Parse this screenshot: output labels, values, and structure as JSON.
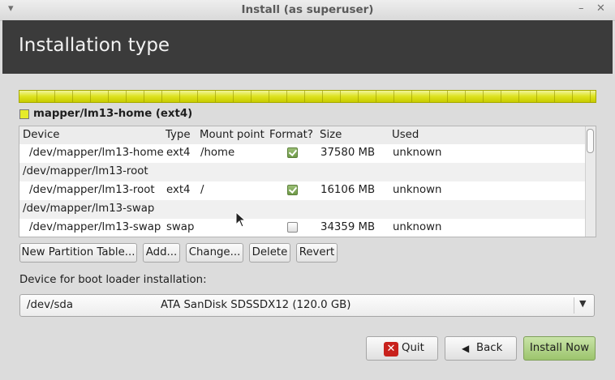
{
  "window": {
    "title": "Install (as superuser)",
    "menu_glyph": "▾",
    "minimize_glyph": "–",
    "close_glyph": "✕"
  },
  "header": {
    "title": "Installation type"
  },
  "colors": {
    "partition_color": "#dde21e",
    "header_bg": "#3b3b3b",
    "install_button": "#9cc46d"
  },
  "selected_partition": {
    "label": "mapper/lm13-home (ext4)"
  },
  "table": {
    "columns": [
      "Device",
      "Type",
      "Mount point",
      "Format?",
      "Size",
      "Used"
    ],
    "rows": [
      {
        "device": "/dev/mapper/lm13-home",
        "type": "ext4",
        "mount": "/home",
        "format": true,
        "size": "37580 MB",
        "used": "unknown"
      },
      {
        "device": "/dev/mapper/lm13-root",
        "type": "",
        "mount": "",
        "format": null,
        "size": "",
        "used": ""
      },
      {
        "device": "/dev/mapper/lm13-root",
        "type": "ext4",
        "mount": "/",
        "format": true,
        "size": "16106 MB",
        "used": "unknown"
      },
      {
        "device": "/dev/mapper/lm13-swap",
        "type": "",
        "mount": "",
        "format": null,
        "size": "",
        "used": ""
      },
      {
        "device": "/dev/mapper/lm13-swap",
        "type": "swap",
        "mount": "",
        "format": false,
        "size": "34359 MB",
        "used": "unknown"
      }
    ]
  },
  "actions": {
    "new_table": "New Partition Table...",
    "add": "Add...",
    "change": "Change...",
    "delete": "Delete",
    "revert": "Revert"
  },
  "bootloader": {
    "label": "Device for boot loader installation:",
    "device": "/dev/sda",
    "description": "ATA SanDisk SDSSDX12 (120.0 GB)"
  },
  "footer": {
    "quit": "Quit",
    "back": "Back",
    "install": "Install Now",
    "back_glyph": "◀"
  }
}
